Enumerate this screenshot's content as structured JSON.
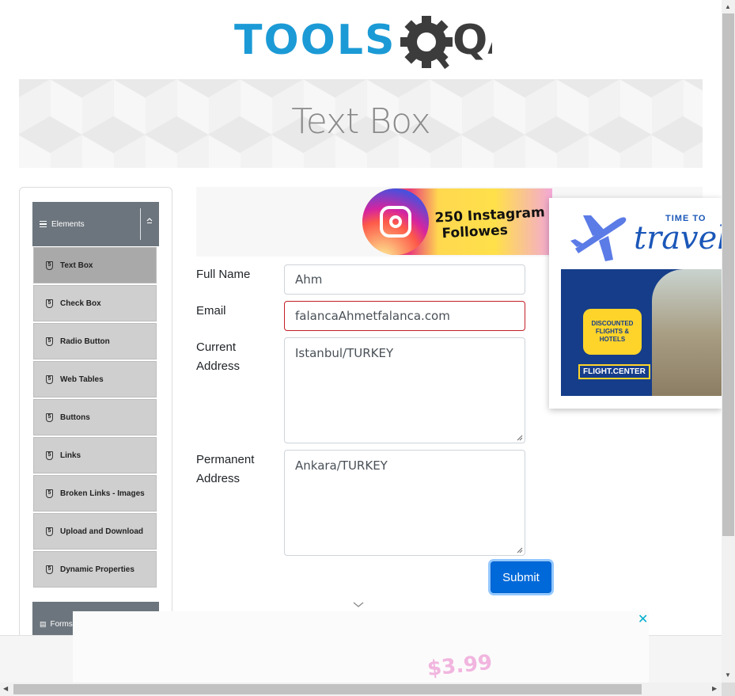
{
  "logo": {
    "text_left": "TOOLS",
    "text_right": "QA",
    "colors": {
      "tools": "#1b9ad6",
      "qa": "#3c3c3c"
    }
  },
  "banner": {
    "title": "Text Box"
  },
  "sidebar": {
    "groups": [
      {
        "label": "Elements",
        "icon": "hamburger-icon",
        "toggle_icon": "collapse-arrow-icon"
      },
      {
        "label": "Forms",
        "icon": "document-icon"
      }
    ],
    "items": [
      {
        "label": "Text Box",
        "active": true
      },
      {
        "label": "Check Box"
      },
      {
        "label": "Radio Button"
      },
      {
        "label": "Web Tables"
      },
      {
        "label": "Buttons"
      },
      {
        "label": "Links"
      },
      {
        "label": "Broken Links - Images"
      },
      {
        "label": "Upload and Download"
      },
      {
        "label": "Dynamic Properties"
      }
    ]
  },
  "form": {
    "full_name": {
      "label": "Full Name",
      "value": "Ahm"
    },
    "email": {
      "label": "Email",
      "value": "falancaAhmetfalanca.com",
      "state": "error"
    },
    "current_address": {
      "label_line1": "Current",
      "label_line2": "Address",
      "value": "Istanbul/TURKEY"
    },
    "permanent_address": {
      "label_line1": "Permanent",
      "label_line2": "Address",
      "value": "Ankara/TURKEY"
    },
    "submit_label": "Submit"
  },
  "ads": {
    "instagram": {
      "text_line1": "250 Instagram",
      "text_line2": "Followes"
    },
    "travel": {
      "small": "TIME TO",
      "script": "travel",
      "bubble_line1": "DISCOUNTED",
      "bubble_line2": "FLIGHTS & HOTELS",
      "brand": "FLIGHT.CENTER"
    },
    "bottom": {
      "price": "$3.99",
      "close": "✕"
    }
  },
  "colors": {
    "accent": "#0069d9",
    "error": "#c11f26",
    "sidebar_header": "#6c757d",
    "menu_item": "#cfcfcf",
    "menu_active": "#a9a9a9"
  }
}
